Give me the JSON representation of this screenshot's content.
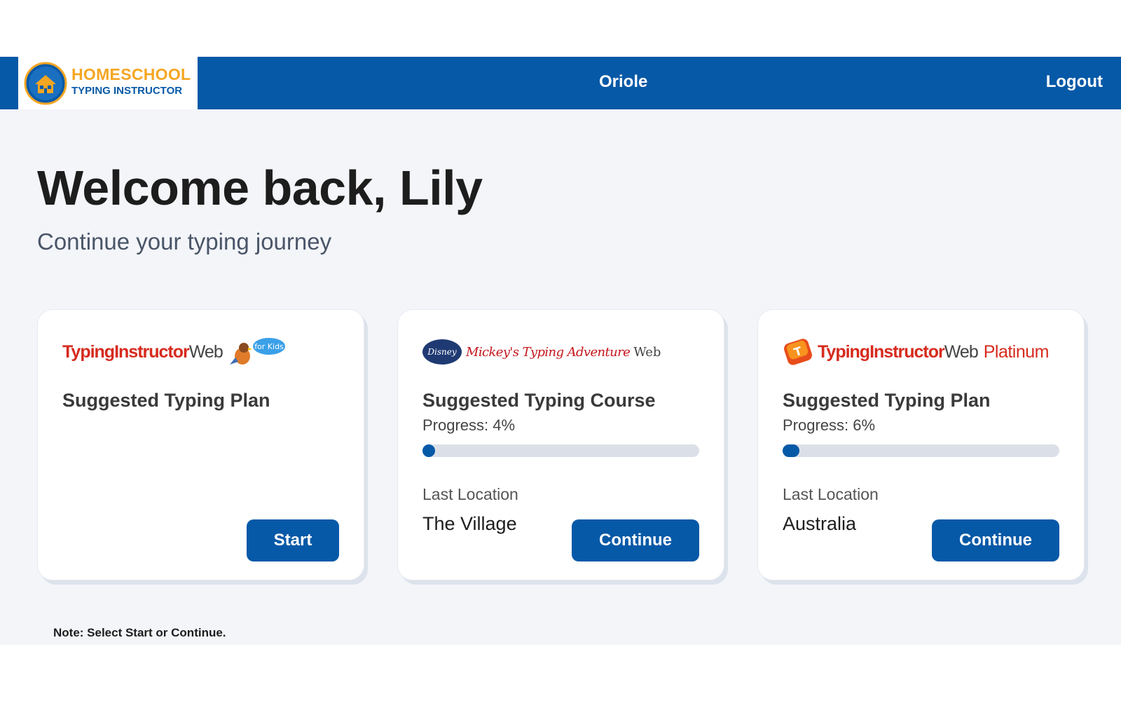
{
  "header": {
    "logo_line1": "HOMESCHOOL",
    "logo_line2": "TYPING INSTRUCTOR",
    "user_name": "Oriole",
    "logout_label": "Logout"
  },
  "main": {
    "welcome_title": "Welcome back, Lily",
    "subtitle": "Continue your typing journey",
    "note": "Note: Select Start or Continue."
  },
  "cards": [
    {
      "logo_brand": "TypingInstructor",
      "logo_web": "Web",
      "logo_badge": "for Kids",
      "title": "Suggested Typing Plan",
      "button_label": "Start"
    },
    {
      "logo_disney": "Disney",
      "logo_brand": "Mickey's Typing Adventure",
      "logo_web": "Web",
      "title": "Suggested Typing Course",
      "progress_text": "Progress: 4%",
      "progress_value": 0.04,
      "last_location_label": "Last Location",
      "last_location_value": "The Village",
      "button_label": "Continue"
    },
    {
      "logo_brand": "TypingInstructor",
      "logo_web": "Web",
      "logo_edition": "Platinum",
      "title": "Suggested Typing Plan",
      "progress_text": "Progress: 6%",
      "progress_value": 0.06,
      "last_location_label": "Last Location",
      "last_location_value": "Australia",
      "button_label": "Continue"
    }
  ],
  "colors": {
    "primary": "#0659a7",
    "logo_orange": "#f5a623",
    "brand_red": "#d62b1e",
    "page_bg": "#f3f5f9",
    "progress_track": "#dbe0e8"
  },
  "icons": {
    "logo": "homeschool-house-emblem-icon",
    "kids_bird": "bird-mascot-icon",
    "platinum_key": "t-key-icon"
  }
}
